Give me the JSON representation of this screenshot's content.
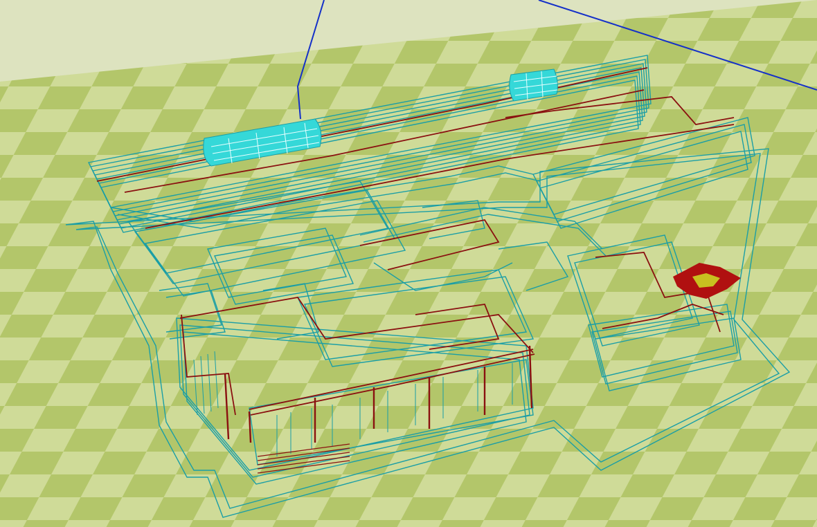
{
  "viewport": {
    "kind": "3d-cad-wireframe-view",
    "colors": {
      "sky": "#dde3bf",
      "ground_light": "#cfdb98",
      "ground_dark": "#b3c66a",
      "wire_primary": "#1a9ea6",
      "wire_secondary": "#8a1010",
      "hvac_units": "#35d8d8",
      "axis_lines": "#1430c8",
      "marker_red": "#b01010",
      "marker_yellow": "#c8c020"
    },
    "icons": [
      "hvac-unit-icon",
      "location-marker-icon",
      "axis-line-icon"
    ]
  }
}
